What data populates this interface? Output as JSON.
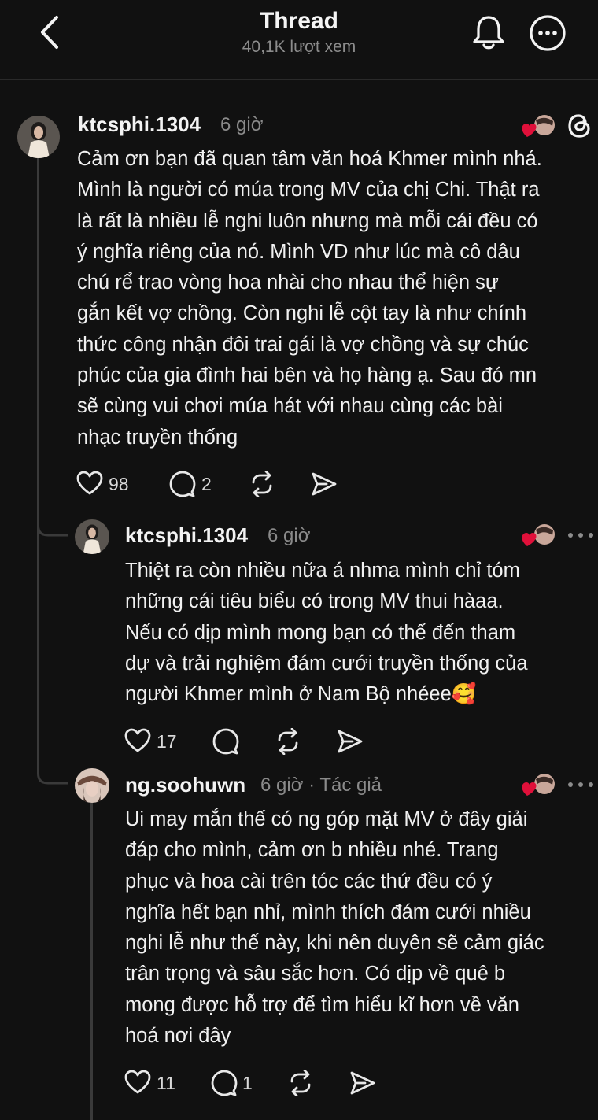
{
  "header": {
    "title": "Thread",
    "views": "40,1K lượt xem",
    "back_icon": "chevron-left-icon",
    "notify_icon": "bell-icon",
    "more_icon": "more-circle-icon"
  },
  "posts": [
    {
      "username": "ktcsphi.1304",
      "time": "6 giờ",
      "lines": [
        "Cảm ơn bạn đã quan tâm văn hoá Khmer mình nhá.",
        "Mình là người có múa trong MV của chị Chi. Thật ra",
        "là rất là nhiều lễ nghi luôn nhưng mà mỗi cái đều có",
        "ý nghĩa riêng của nó. Mình VD như lúc mà cô dâu",
        "chú rể trao vòng hoa nhài cho nhau thể hiện sự",
        "gắn kết vợ chồng. Còn nghi lễ cột tay là như chính",
        "thức công nhận đôi trai gái là vợ chồng và sự chúc",
        "phúc của gia đình hai bên và họ hàng ạ. Sau đó mn",
        "sẽ cùng vui chơi múa hát với nhau cùng các bài",
        "nhạc truyền thống"
      ],
      "likes": "98",
      "replies": "2"
    },
    {
      "username": "ktcsphi.1304",
      "time": "6 giờ",
      "lines": [
        "Thiệt ra còn nhiều nữa á nhma mình chỉ tóm",
        "những cái tiêu biểu có trong MV thui hàaa.",
        "Nếu có dịp mình mong bạn có thể đến tham",
        "dự và trải nghiệm  đám cưới truyền thống của",
        "người Khmer mình ở Nam Bộ nhéee🥰"
      ],
      "likes": "17"
    },
    {
      "username": "ng.soohuwn",
      "time": "6 giờ · Tác giả",
      "lines": [
        "Ui may mắn thế có ng góp mặt MV ở đây giải",
        "đáp cho mình, cảm ơn b nhiều nhé. Trang",
        "phục và hoa cài trên tóc các thứ đều có ý",
        "nghĩa hết bạn nhỉ, mình thích đám cưới nhiều",
        "nghi lễ như thế này, khi nên duyên sẽ cảm giác",
        "trân trọng và sâu sắc hơn. Có dịp về quê b",
        "mong được hỗ trợ để tìm hiểu kĩ hơn về văn",
        "hoá nơi đây"
      ],
      "likes": "11",
      "replies": "1"
    }
  ],
  "colors": {
    "background": "#111111",
    "heart": "#e0103a",
    "muted": "#8a8a8a"
  }
}
